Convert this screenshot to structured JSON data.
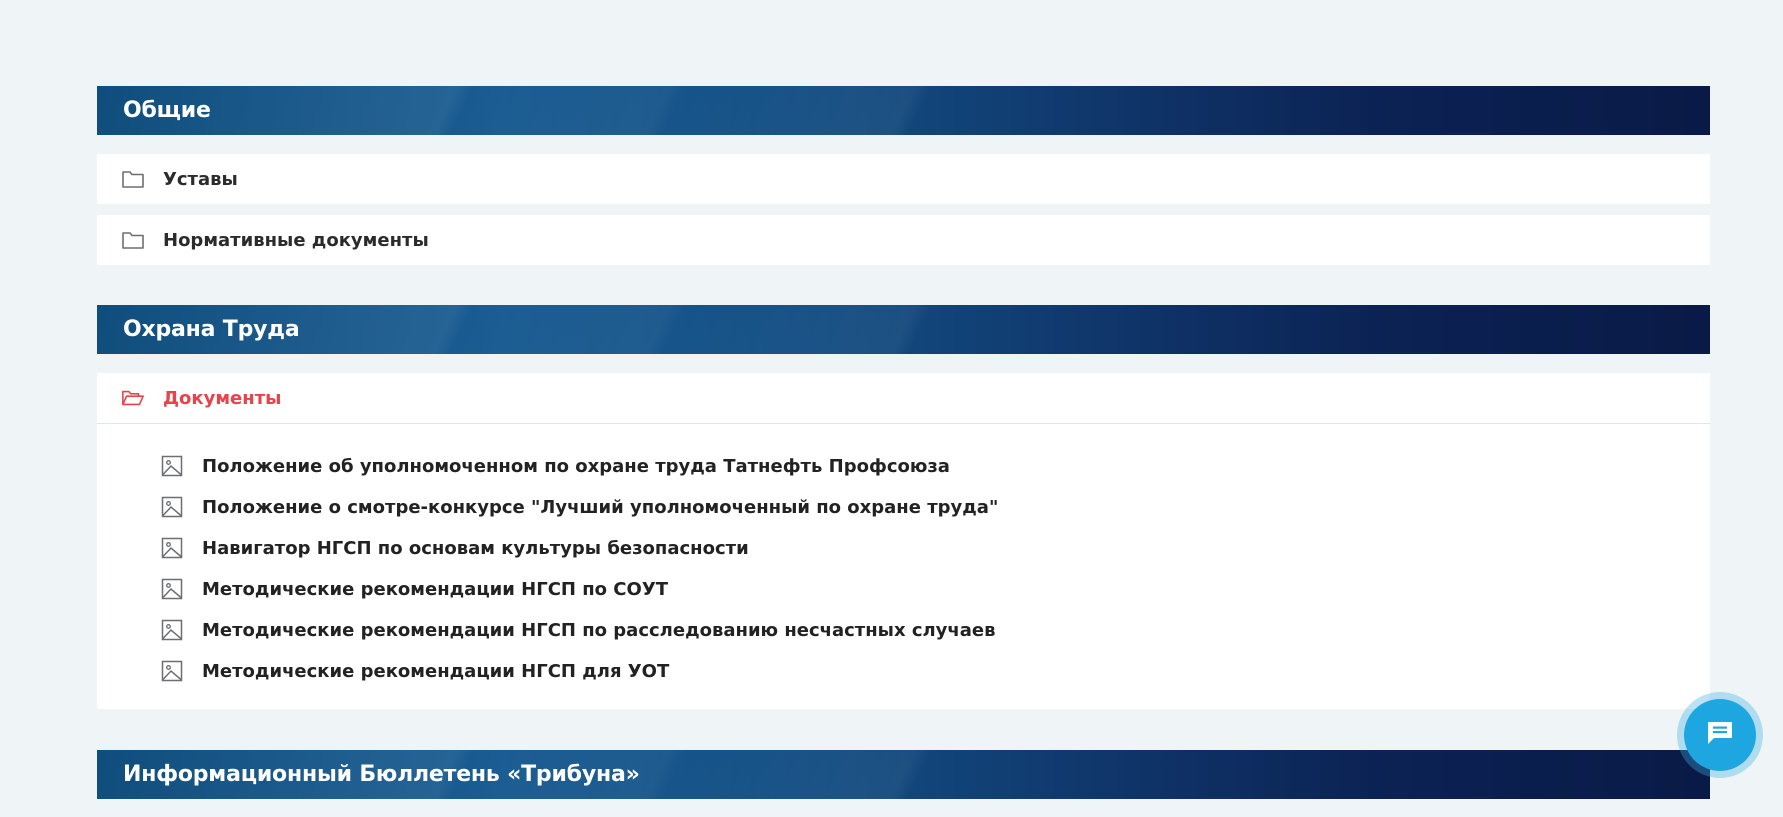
{
  "sections": [
    {
      "title": "Общие",
      "folders": [
        {
          "label": "Уставы",
          "icon": "folder-icon"
        },
        {
          "label": "Нормативные документы",
          "icon": "folder-icon"
        }
      ]
    },
    {
      "title": "Охрана Труда",
      "folders": [
        {
          "label": "Документы",
          "icon": "folder-open-icon",
          "expanded": true
        }
      ],
      "documents": [
        "Положение об уполномоченном по охране труда Татнефть Профсоюза",
        "Положение о смотре-конкурсе \"Лучший уполномоченный по охране труда\"",
        "Навигатор НГСП по основам культуры безопасности",
        "Методические рекомендации НГСП по СОУТ",
        "Методические рекомендации НГСП по расследованию несчастных случаев",
        "Методические рекомендации НГСП для УОТ"
      ]
    },
    {
      "title": "Информационный Бюллетень «Трибуна»"
    }
  ],
  "chat_button": {
    "icon": "chat-message-icon"
  },
  "colors": {
    "background": "#eff4f7",
    "header_start": "#0f4d7d",
    "header_end": "#0a1a47",
    "active_folder": "#e8434a",
    "fab": "#1ea6e0"
  }
}
